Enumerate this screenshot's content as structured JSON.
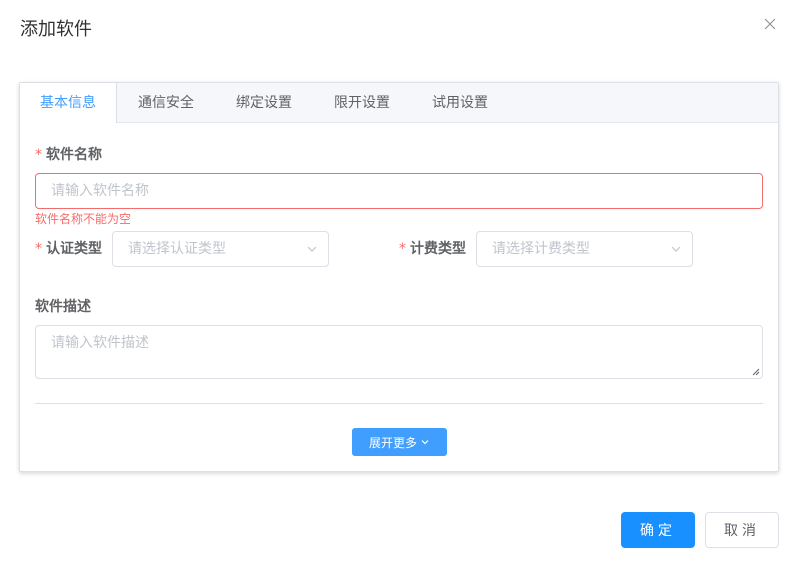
{
  "dialog": {
    "title": "添加软件",
    "close_icon": "close-icon"
  },
  "tabs": [
    {
      "label": "基本信息",
      "active": true
    },
    {
      "label": "通信安全",
      "active": false
    },
    {
      "label": "绑定设置",
      "active": false
    },
    {
      "label": "限开设置",
      "active": false
    },
    {
      "label": "试用设置",
      "active": false
    }
  ],
  "form": {
    "software_name": {
      "required_mark": "*",
      "label": "软件名称",
      "placeholder": "请输入软件名称",
      "value": "",
      "error": "软件名称不能为空"
    },
    "auth_type": {
      "required_mark": "*",
      "label": "认证类型",
      "placeholder": "请选择认证类型",
      "value": ""
    },
    "billing_type": {
      "required_mark": "*",
      "label": "计费类型",
      "placeholder": "请选择计费类型",
      "value": ""
    },
    "description": {
      "label": "软件描述",
      "placeholder": "请输入软件描述",
      "value": ""
    },
    "expand_label": "展开更多"
  },
  "footer": {
    "confirm_label": "确定",
    "cancel_label": "取消"
  },
  "colors": {
    "primary": "#409eff",
    "confirm": "#1890ff",
    "error": "#f56c6c",
    "border": "#dcdfe6"
  }
}
